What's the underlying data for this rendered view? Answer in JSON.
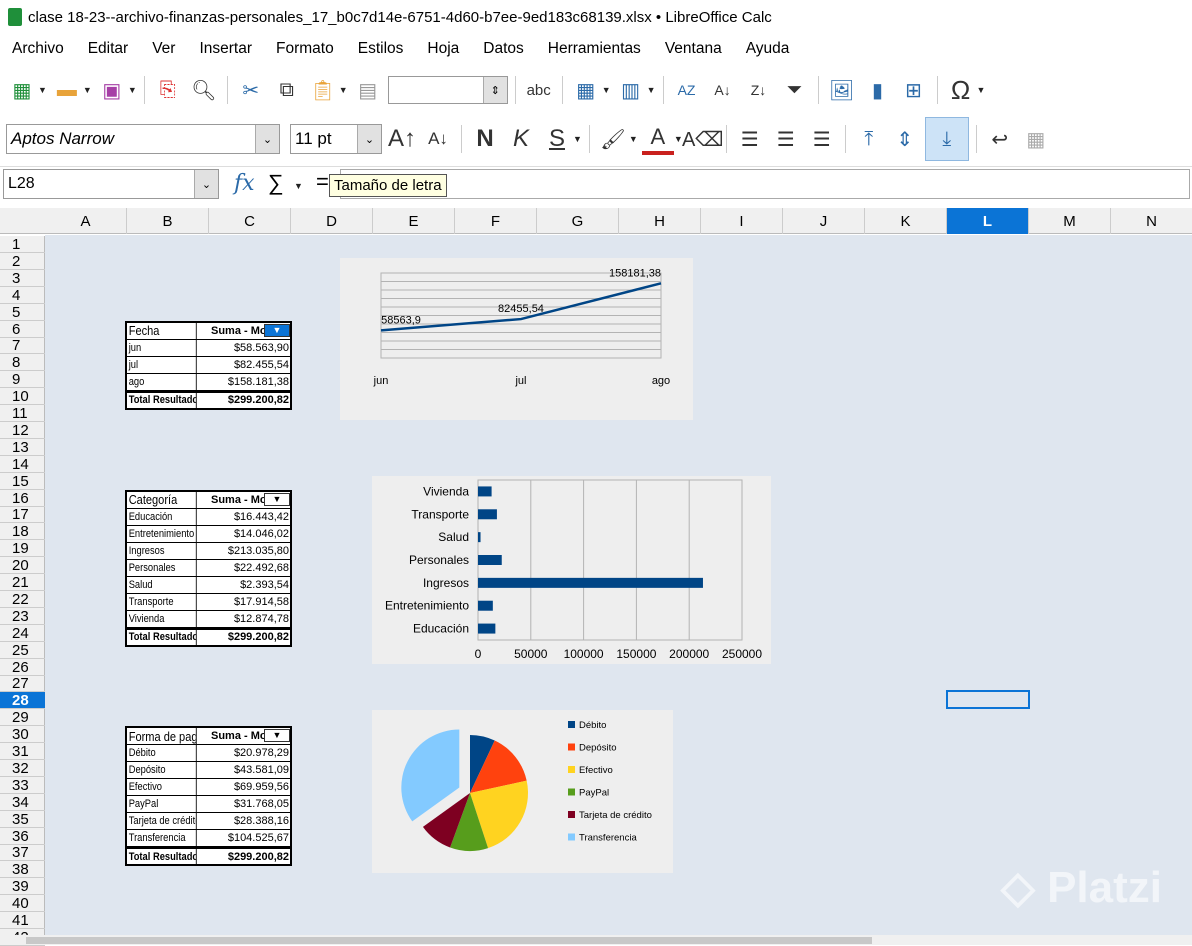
{
  "window": {
    "title": "clase 18-23--archivo-finanzas-personales_17_b0c7d14e-6751-4d60-b7ee-9ed183c68139.xlsx • LibreOffice Calc"
  },
  "menu": [
    "Archivo",
    "Editar",
    "Ver",
    "Insertar",
    "Formato",
    "Estilos",
    "Hoja",
    "Datos",
    "Herramientas",
    "Ventana",
    "Ayuda"
  ],
  "toolbar": {
    "font_name": "Aptos Narrow",
    "font_size": "11 pt",
    "bold": "N",
    "italic": "K",
    "underline": "S"
  },
  "formula_bar": {
    "cell_ref": "L28",
    "content": "",
    "tooltip": "Tamaño de letra"
  },
  "columns": [
    "A",
    "B",
    "C",
    "D",
    "E",
    "F",
    "G",
    "H",
    "I",
    "J",
    "K",
    "L",
    "M",
    "N"
  ],
  "selected_column": "L",
  "selected_row": 28,
  "pivot_fecha": {
    "header": "Fecha",
    "value_header": "Suma - Monto",
    "rows": [
      [
        "jun",
        "$58.563,90"
      ],
      [
        "jul",
        "$82.455,54"
      ],
      [
        "ago",
        "$158.181,38"
      ]
    ],
    "total": [
      "Total Resultado",
      "$299.200,82"
    ]
  },
  "pivot_categoria": {
    "header": "Categoría",
    "value_header": "Suma - Monto",
    "rows": [
      [
        "Educación",
        "$16.443,42"
      ],
      [
        "Entretenimiento",
        "$14.046,02"
      ],
      [
        "Ingresos",
        "$213.035,80"
      ],
      [
        "Personales",
        "$22.492,68"
      ],
      [
        "Salud",
        "$2.393,54"
      ],
      [
        "Transporte",
        "$17.914,58"
      ],
      [
        "Vivienda",
        "$12.874,78"
      ]
    ],
    "total": [
      "Total Resultado",
      "$299.200,82"
    ]
  },
  "pivot_forma": {
    "header": "Forma de pago",
    "value_header": "Suma - Monto",
    "rows": [
      [
        "Débito",
        "$20.978,29"
      ],
      [
        "Depósito",
        "$43.581,09"
      ],
      [
        "Efectivo",
        "$69.959,56"
      ],
      [
        "PayPal",
        "$31.768,05"
      ],
      [
        "Tarjeta de crédito",
        "$28.388,16"
      ],
      [
        "Transferencia",
        "$104.525,67"
      ]
    ],
    "total": [
      "Total Resultado",
      "$299.200,82"
    ]
  },
  "chart_data": [
    {
      "type": "line",
      "categories": [
        "jun",
        "jul",
        "ago"
      ],
      "values": [
        58563.9,
        82455.54,
        158181.38
      ],
      "data_labels": [
        "58563,9",
        "82455,54",
        "158181,38"
      ],
      "color": "#004586"
    },
    {
      "type": "bar",
      "orientation": "horizontal",
      "categories": [
        "Vivienda",
        "Transporte",
        "Salud",
        "Personales",
        "Ingresos",
        "Entretenimiento",
        "Educación"
      ],
      "values": [
        12874.78,
        17914.58,
        2393.54,
        22492.68,
        213035.8,
        14046.02,
        16443.42
      ],
      "xlim": [
        0,
        250000
      ],
      "ticks": [
        "0",
        "50000",
        "100000",
        "150000",
        "200000",
        "250000"
      ],
      "color": "#004586"
    },
    {
      "type": "pie",
      "categories": [
        "Débito",
        "Depósito",
        "Efectivo",
        "PayPal",
        "Tarjeta de crédito",
        "Transferencia"
      ],
      "values": [
        20978.29,
        43581.09,
        69959.56,
        31768.05,
        28388.16,
        104525.67
      ],
      "colors": [
        "#004586",
        "#ff420e",
        "#ffd320",
        "#579d1c",
        "#7e0021",
        "#83caff"
      ],
      "legend": "right"
    }
  ],
  "watermark": "Platzi"
}
